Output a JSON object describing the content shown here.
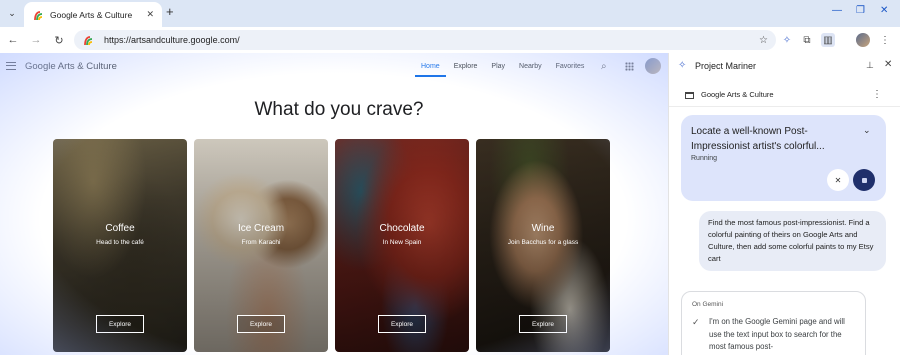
{
  "browser": {
    "tab": {
      "title": "Google Arts & Culture"
    },
    "url": "https://artsandculture.google.com/"
  },
  "site": {
    "logo": "Google Arts & Culture",
    "nav": [
      "Home",
      "Explore",
      "Play",
      "Nearby",
      "Favorites"
    ],
    "active_nav": "Home",
    "heading": "What do you crave?",
    "cards": [
      {
        "title": "Coffee",
        "subtitle": "Head to the café",
        "button": "Explore"
      },
      {
        "title": "Ice Cream",
        "subtitle": "From Karachi",
        "button": "Explore"
      },
      {
        "title": "Chocolate",
        "subtitle": "In New Spain",
        "button": "Explore"
      },
      {
        "title": "Wine",
        "subtitle": "Join Bacchus for a glass",
        "button": "Explore"
      }
    ]
  },
  "panel": {
    "title": "Project Mariner",
    "context_tab": "Google Arts & Culture",
    "task": {
      "title": "Locate a well-known Post-Impressionist artist's colorful...",
      "status": "Running"
    },
    "user_message": "Find the most famous post-impressionist. Find a colorful painting of theirs on Google Arts and Culture, then add some colorful paints to my Etsy cart",
    "gemini": {
      "label": "On Gemini",
      "text": "I'm on the Google Gemini page and will use the text input box to search for the most famous post-"
    }
  },
  "colors": {
    "accent": "#1a73e8",
    "task_card": "#dde4fb",
    "stop_button": "#1f2f6b",
    "window_frame": "#dce6f5"
  }
}
